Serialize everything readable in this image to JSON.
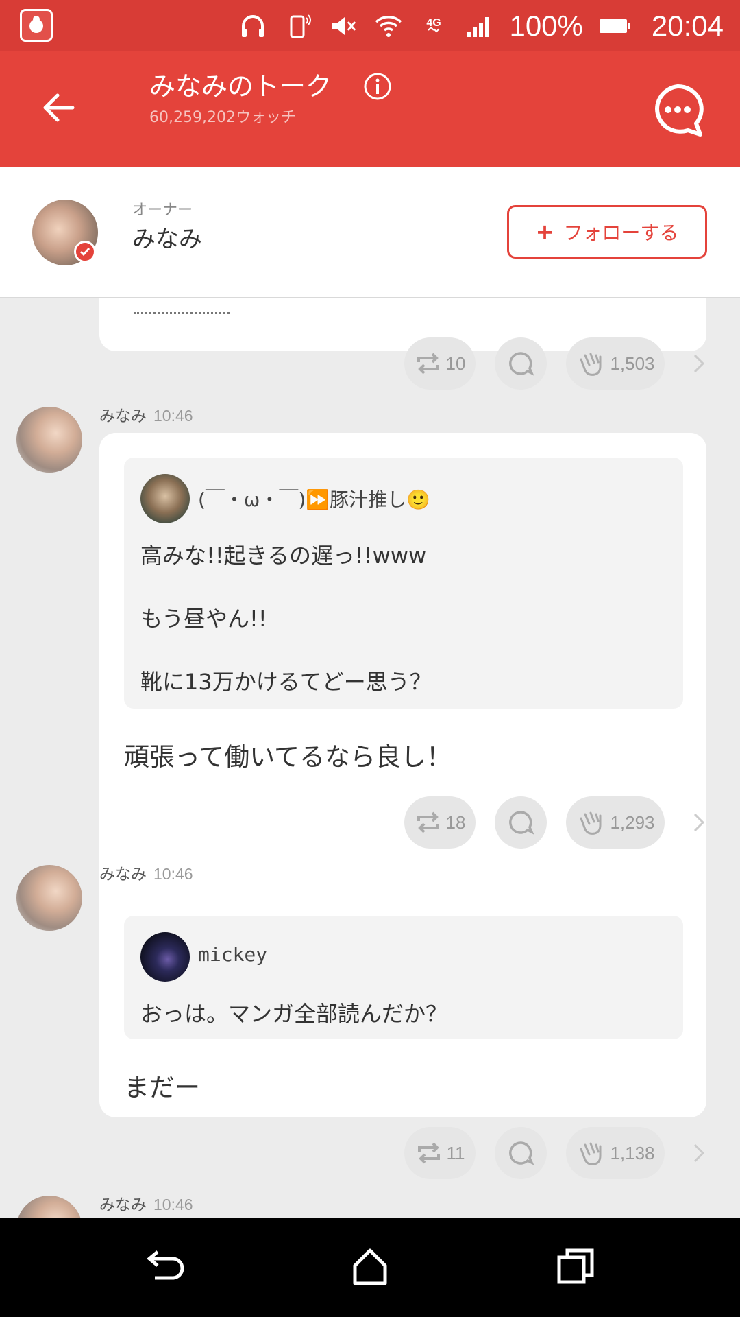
{
  "status_bar": {
    "battery": "100%",
    "time": "20:04",
    "network": "4G",
    "icons": [
      "app-notification-icon",
      "headphones-icon",
      "vibrate-icon",
      "mute-icon",
      "wifi-icon",
      "signal-icon",
      "battery-icon"
    ]
  },
  "header": {
    "title": "みなみのトーク",
    "watch_count": "60,259,202ウォッチ",
    "icons": [
      "back-arrow-icon",
      "info-icon",
      "chat-menu-icon"
    ]
  },
  "owner": {
    "label": "オーナー",
    "name": "みなみ",
    "follow_label": "フォローする"
  },
  "feed": {
    "top_actions": {
      "retalk": "10",
      "applause": "1,503"
    },
    "posts": [
      {
        "author": "みなみ",
        "time": "10:46",
        "quote_user": "(￣・ω・￣)⏩豚汁推し🙂",
        "quote_lines": [
          "高みな!!起きるの遅っ!!www",
          "",
          "もう昼やん!!",
          "",
          "靴に13万かけるてどー思う？"
        ],
        "reply": "頑張って働いてるなら良し！",
        "retalk": "18",
        "applause": "1,293"
      },
      {
        "author": "みなみ",
        "time": "10:46",
        "quote_user": "mickey",
        "quote_lines": [
          "おっは。マンガ全部読んだか？"
        ],
        "reply": "まだー",
        "retalk": "11",
        "applause": "1,138"
      },
      {
        "author": "みなみ",
        "time": "10:46"
      }
    ]
  },
  "colors": {
    "brand_red": "#e4433b",
    "status_red": "#d83c36",
    "background": "#ececec"
  }
}
